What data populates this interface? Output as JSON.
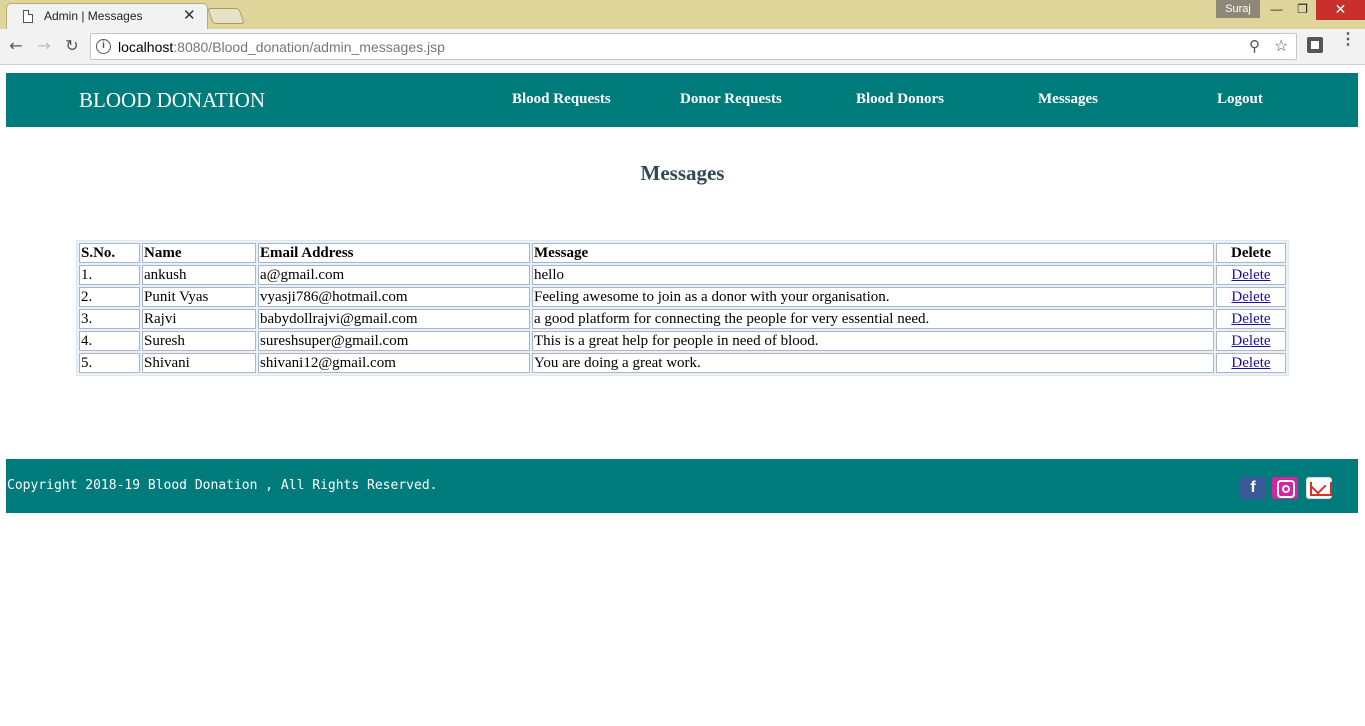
{
  "browser": {
    "tab_title": "Admin | Messages",
    "tab_close": "✕",
    "user_name": "Suraj",
    "url_host": "localhost",
    "url_rest": ":8080/Blood_donation/admin_messages.jsp"
  },
  "header": {
    "brand": "BLOOD DONATION",
    "nav": [
      "Blood Requests",
      "Donor Requests",
      "Blood Donors",
      "Messages",
      "Logout"
    ]
  },
  "page": {
    "title": "Messages"
  },
  "table": {
    "columns": [
      "S.No.",
      "Name",
      "Email Address",
      "Message",
      "Delete"
    ],
    "rows": [
      {
        "sno": "1.",
        "name": "ankush",
        "email": "a@gmail.com",
        "message": "hello",
        "action": "Delete"
      },
      {
        "sno": "2.",
        "name": "Punit Vyas",
        "email": "vyasji786@hotmail.com",
        "message": "Feeling awesome to join as a donor with your organisation.",
        "action": "Delete"
      },
      {
        "sno": "3.",
        "name": "Rajvi",
        "email": "babydollrajvi@gmail.com",
        "message": "a good platform for connecting the people for very essential need.",
        "action": "Delete"
      },
      {
        "sno": "4.",
        "name": "Suresh",
        "email": "sureshsuper@gmail.com",
        "message": "This is a great help for people in need of blood.",
        "action": "Delete"
      },
      {
        "sno": "5.",
        "name": "Shivani",
        "email": "shivani12@gmail.com",
        "message": "You are doing a great work.",
        "action": "Delete"
      }
    ]
  },
  "footer": {
    "copyright": "Copyright 2018-19 Blood Donation , All Rights Reserved.",
    "social": [
      "facebook-icon",
      "instagram-icon",
      "gmail-icon"
    ]
  },
  "colors": {
    "teal": "#007b7b",
    "heading": "#2e4b4f",
    "link": "#1a0dab"
  }
}
